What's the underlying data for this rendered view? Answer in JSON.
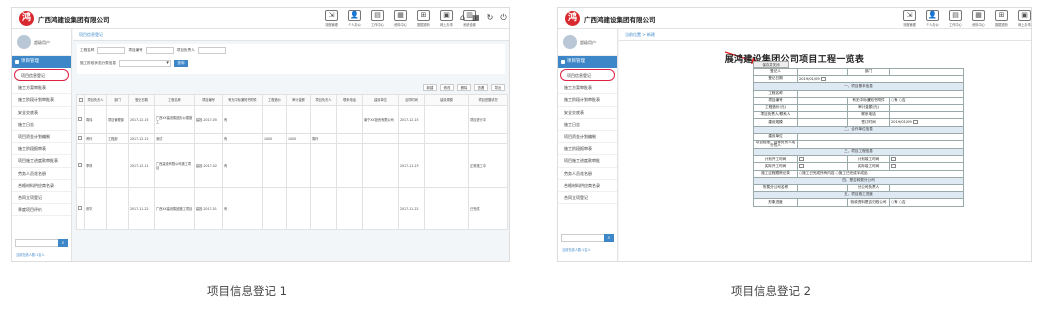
{
  "company_name": "广西鸿建设集团有限公司",
  "logo_glyph": "鸿",
  "toolbar": [
    {
      "label": "流程管理",
      "icon": "arrow-icon"
    },
    {
      "label": "个人办公",
      "icon": "user-icon"
    },
    {
      "label": "工作中心",
      "icon": "print-icon"
    },
    {
      "label": "资料中心",
      "icon": "document-icon"
    },
    {
      "label": "数据透析",
      "icon": "chart-icon"
    },
    {
      "label": "网上办事",
      "icon": "folder-icon"
    },
    {
      "label": "系统设置",
      "icon": "trash-icon"
    }
  ],
  "user": {
    "name": "超级用户"
  },
  "sidebar": {
    "header": "项目管理",
    "items": [
      "项目信息登记",
      "施工方案审批表",
      "施工阶段计划审批表",
      "安全交底表",
      "施工日志",
      "项目资金计划编制",
      "施工阶段报审表",
      "项目施工进度款审批表",
      "劳务人员花名册",
      "合格材料供应商名录",
      "合同立项登记",
      "季度项目评价"
    ],
    "footer": "当前在线人数:1名人"
  },
  "sidebar2": {
    "items": [
      "项目信息登记",
      "施工方案审批表",
      "施工阶段计划审批表",
      "安全交底表",
      "施工日志",
      "项目资金计划编制",
      "施工阶段报审表",
      "项目施工进度款审批",
      "劳务人员花名册",
      "合格材料供应商名录",
      "合同立项登记",
      "季度项目评价表"
    ]
  },
  "screen1": {
    "breadcrumb": "项目信息登记",
    "filter": {
      "label1": "工程名称",
      "label2": "项目编号",
      "label3": "项目负责人",
      "label4": "施工阶段状态分类信息",
      "search": "查询"
    },
    "buttons": [
      "新建",
      "修改",
      "删除",
      "查看",
      "导出"
    ],
    "columns": [
      "",
      "项目负责人",
      "部门",
      "登记日期",
      "工程名称",
      "项目编号",
      "有无中标通知书附件",
      "工程造价",
      "审计金额",
      "项目负责人",
      "联系电话",
      "建设单位",
      "合同时间",
      "建设规模",
      "项目进展状况"
    ],
    "rows": [
      [
        "",
        "周伟",
        "项目管理部",
        "2017-12-15",
        "广西XX建设集团办公楼施工",
        "建投-2017-05",
        "有",
        "",
        "",
        "",
        "",
        "南宁XX投资有限公司",
        "2017-12-15",
        "",
        "项目进行中"
      ],
      [
        "",
        "黄玲",
        "工程部",
        "2017-12-12",
        "测试",
        "",
        "有",
        "1000",
        "1000",
        "周玲",
        "",
        "",
        "",
        "",
        ""
      ],
      [
        "",
        "李林",
        "",
        "2017-12-11",
        "广西建设有限公司施工项目",
        "建投-2017-02",
        "有",
        "",
        "",
        "",
        "",
        "",
        "2017-11-23",
        "",
        "正常施工中"
      ],
      [
        "",
        "张华",
        "",
        "2017-11-22",
        "广西XX建设集团施工项目",
        "建投-2017-01",
        "有",
        "",
        "",
        "",
        "",
        "",
        "2017-11-22",
        "",
        "已完成"
      ]
    ]
  },
  "screen2": {
    "breadcrumb": "当前位置 > 新建",
    "form_title": "展鸿建设集团公司项目工程一览表",
    "save_button": "保存并关闭",
    "fields": {
      "registrant": "登记人",
      "department": "部门",
      "reg_date": "登记日期",
      "reg_date_value": "2019/01/09",
      "section1": "一、项目基本信息",
      "project_name": "工程名称",
      "project_no": "项目编号",
      "bid_notice": "有无中标通知书附件",
      "yes": "有",
      "no": "否",
      "cost": "工程造价(元)",
      "audit": "审计金额(元)",
      "manager": "项目负责人/联系人",
      "phone": "联系电话",
      "scale": "建设规模",
      "contract_time": "签订时间",
      "contract_time_value": "2019/01/09",
      "section2": "二、合作单位信息",
      "builder": "建设单位",
      "builder_contact": "项目经理、技术负责人或分包人",
      "section3": "三、项目工程信息",
      "plan_start": "计划开工时间",
      "plan_end": "计划竣工时间",
      "actual_start": "实际开工时间",
      "actual_end": "实际竣工时间",
      "progress": "施工过程跟踪记录",
      "opt1": "施工已完成所有内容",
      "opt2": "施工已完成半成品",
      "section4": "四、是否转费分公司",
      "branch": "所属分公司名称",
      "branch_mgr": "分公司负责人",
      "section5": "五、项目施工进度",
      "progress_desc": "形象进度",
      "acceptance": "验收资料是否归档公司"
    }
  },
  "captions": [
    "项目信息登记 1",
    "项目信息登记 2"
  ],
  "colors": {
    "accent": "#3d87c9",
    "logo": "#d8292f",
    "highlight": "#d22244"
  }
}
